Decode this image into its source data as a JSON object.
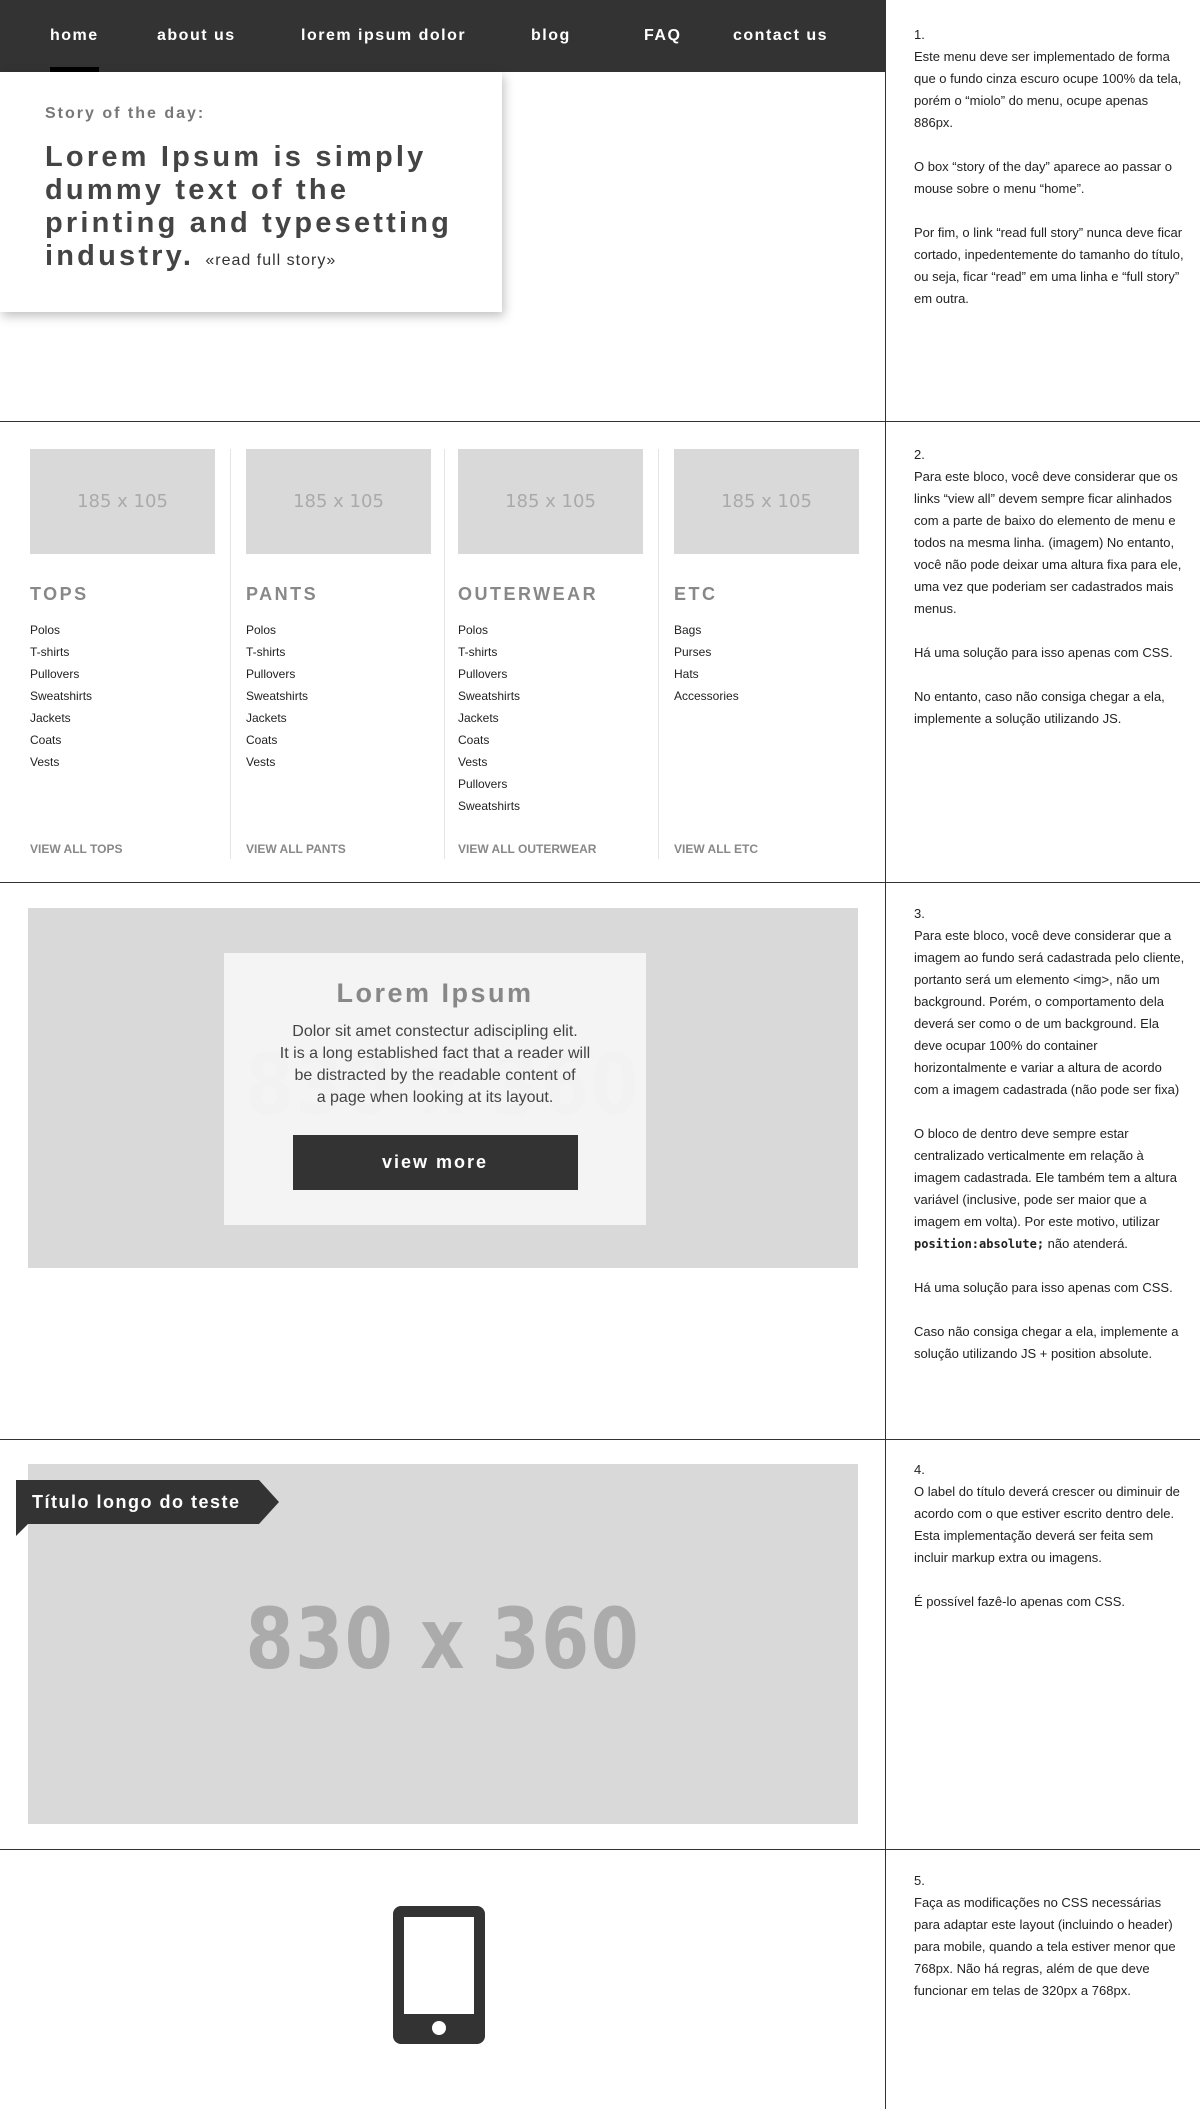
{
  "nav": {
    "items": [
      "home",
      "about us",
      "lorem ipsum dolor",
      "blog",
      "FAQ",
      "contact us"
    ]
  },
  "story": {
    "kicker": "Story of the day:",
    "headline": "Lorem Ipsum is simply dummy text of the printing and typesetting industry.",
    "link": "«read full story»"
  },
  "categories": [
    {
      "image": "185 x 105",
      "title": "TOPS",
      "items": [
        "Polos",
        "T-shirts",
        "Pullovers",
        "Sweatshirts",
        "Jackets",
        "Coats",
        "Vests"
      ],
      "view_all": "VIEW ALL TOPS"
    },
    {
      "image": "185 x 105",
      "title": "PANTS",
      "items": [
        "Polos",
        "T-shirts",
        "Pullovers",
        "Sweatshirts",
        "Jackets",
        "Coats",
        "Vests"
      ],
      "view_all": "VIEW ALL PANTS"
    },
    {
      "image": "185 x 105",
      "title": "OUTERWEAR",
      "items": [
        "Polos",
        "T-shirts",
        "Pullovers",
        "Sweatshirts",
        "Jackets",
        "Coats",
        "Vests",
        "Pullovers",
        "Sweatshirts"
      ],
      "view_all": "VIEW ALL OUTERWEAR"
    },
    {
      "image": "185 x 105",
      "title": "ETC",
      "items": [
        "Bags",
        "Purses",
        "Hats",
        "Accessories"
      ],
      "view_all": "VIEW ALL ETC"
    }
  ],
  "banner": {
    "image": "830 x 360",
    "title": "Lorem Ipsum",
    "lines": [
      "Dolor sit amet constectur adiscipling elit.",
      "It is a long established fact that a reader will",
      "be distracted by the readable content of",
      "a page when looking at its layout."
    ],
    "button": "view more"
  },
  "banner2": {
    "image": "830 x 360",
    "label": "Título longo do teste"
  },
  "notes": {
    "n1": {
      "p1_num": "1.",
      "p1": "Este menu deve ser implementado de forma que o fundo cinza escuro ocupe 100% da tela, porém o “miolo” do menu, ocupe apenas 886px.",
      "p2": "O box “story of the day” aparece ao passar o mouse sobre o menu “home”.",
      "p3": "Por fim, o link “read full story” nunca deve ficar cortado, inpedentemente do tamanho do título, ou seja, ficar “read” em uma linha e “full story” em outra."
    },
    "n2": {
      "p1_num": "2.",
      "p1": "Para este bloco, você deve considerar que os links “view all” devem sempre ficar alinhados com a parte de baixo do elemento de menu e todos na mesma linha. (imagem) No entanto, você não pode deixar uma altura fixa para ele, uma vez que poderiam ser cadastrados mais menus.",
      "p2": "Há uma solução para isso apenas com CSS.",
      "p3": "No entanto, caso não consiga chegar a ela, implemente a solução utilizando JS."
    },
    "n3": {
      "p1_num": "3.",
      "p1": "Para este bloco, você deve considerar que a imagem ao fundo será cadastrada pelo cliente, portanto será um elemento <img>, não um background. Porém, o comportamento dela deverá ser como o de um background. Ela deve ocupar 100% do container horizontalmente e variar a altura de acordo com a imagem cadastrada (não pode ser fixa)",
      "p2_a": "O bloco de dentro deve sempre estar centralizado verticalmente em relação à imagem cadastrada. Ele também tem a altura variável (inclusive, pode ser maior que a imagem em volta). Por este motivo, utilizar",
      "p2_code": "position:absolute;",
      "p2_b": "não atenderá.",
      "p3": "Há uma solução para isso apenas com CSS.",
      "p4": "Caso não consiga chegar a ela, implemente a solução utilizando JS + position absolute."
    },
    "n4": {
      "p1_num": "4.",
      "p1": "O label do título deverá crescer ou diminuir de acordo com o que estiver escrito dentro dele. Esta implementação deverá ser feita sem incluir markup extra ou imagens.",
      "p2": "É possível fazê-lo apenas com CSS."
    },
    "n5": {
      "p1_num": "5.",
      "p1": "Faça as modificações no CSS necessárias para adaptar este layout (incluindo o header) para mobile, quando a tela estiver menor que 768px. Não há regras, além de que deve funcionar em telas de 320px a 768px."
    }
  },
  "icons": {
    "phone": "smartphone-icon"
  }
}
